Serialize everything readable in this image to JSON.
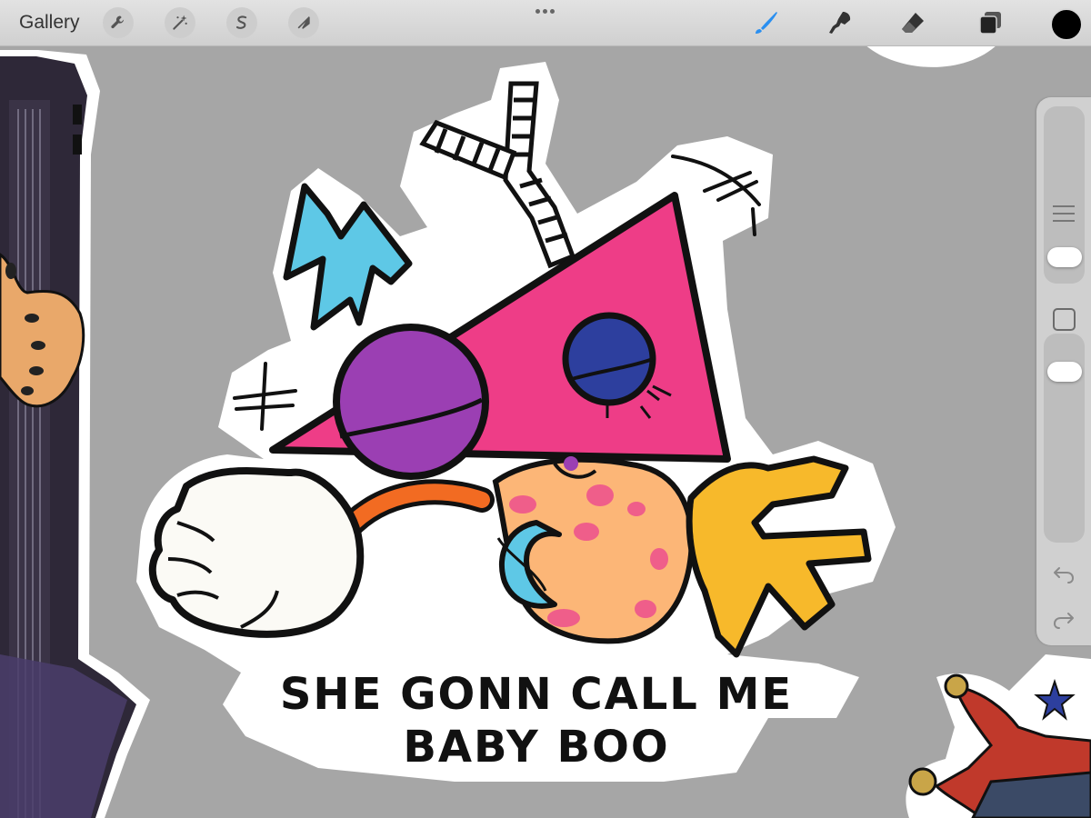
{
  "toolbar": {
    "gallery_label": "Gallery",
    "left_tools": [
      "wrench-icon",
      "magic-wand-icon",
      "selection-s-icon",
      "transform-arrow-icon"
    ],
    "right_tools": [
      "brush-icon",
      "smudge-icon",
      "eraser-icon",
      "layers-icon"
    ],
    "brush_accent": "#2a8ff0",
    "current_color": "#000000"
  },
  "sidebar": {
    "brush_size_icon": "size-lines-icon",
    "modify_button_icon": "square-icon",
    "undo_icon": "undo-icon",
    "redo_icon": "redo-icon"
  },
  "artwork": {
    "caption_line1": "SHE GONN CALL ME",
    "caption_line2": "BABY BOO",
    "colors": {
      "canvas_bg": "#a6a6a6",
      "triangle": "#ee3d87",
      "purple_ball": "#9b3fb3",
      "blue_ball": "#2d3f9e",
      "bolt": "#5ec8e6",
      "yellow_hand": "#f7b92b",
      "orange_body": "#fcb677",
      "spots": "#ef5e8a",
      "glove": "#fbfaf5",
      "arm": "#f26b22"
    }
  }
}
